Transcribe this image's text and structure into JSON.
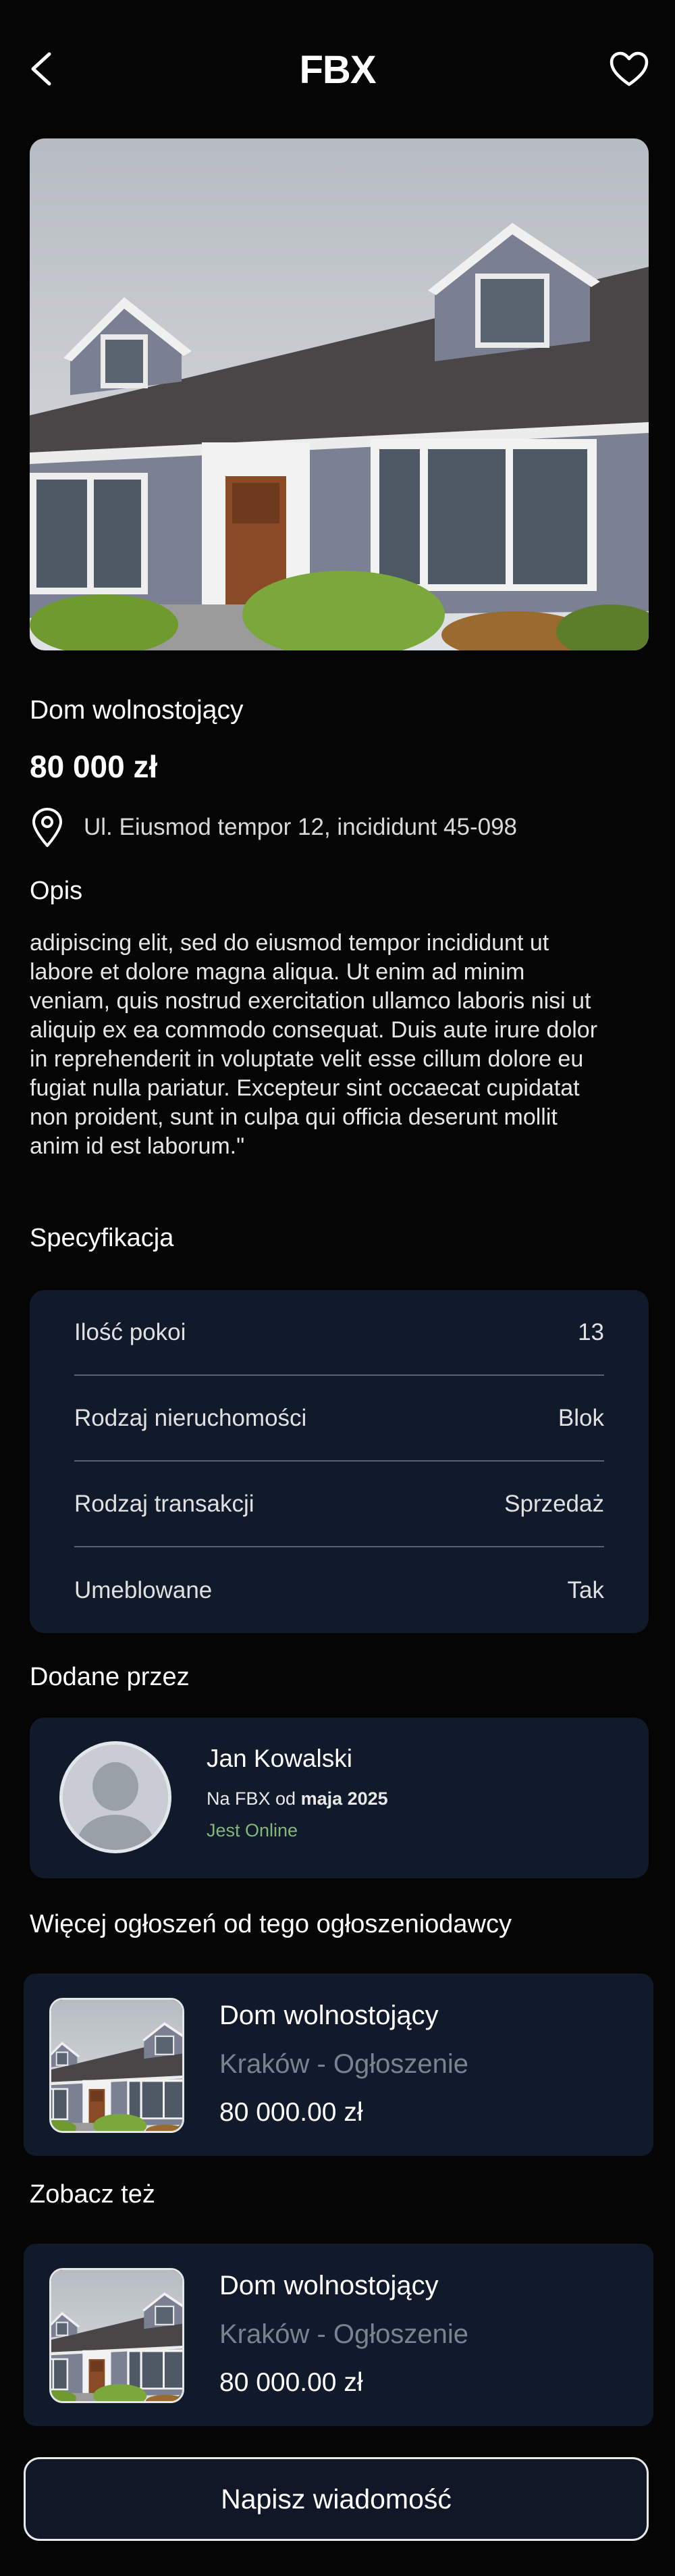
{
  "header": {
    "logo": "FBX",
    "back_icon": "chevron-left-icon",
    "favorite_icon": "heart-icon"
  },
  "listing": {
    "title": "Dom wolnostojący",
    "price": "80 000 zł",
    "address": "Ul. Eiusmod tempor 12, incididunt 45-098",
    "description_label": "Opis",
    "description": "adipiscing elit, sed do eiusmod tempor incididunt ut labore et dolore magna aliqua. Ut enim ad minim veniam, quis nostrud exercitation ullamco laboris nisi ut aliquip ex ea commodo consequat. Duis aute irure dolor in reprehenderit in voluptate velit esse cillum dolore eu fugiat nulla pariatur. Excepteur sint occaecat cupidatat non proident, sunt in culpa qui officia deserunt mollit anim id est laborum.\""
  },
  "specs": {
    "label": "Specyfikacja",
    "rows": [
      {
        "key": "Ilość pokoi",
        "value": "13"
      },
      {
        "key": "Rodzaj nieruchomości",
        "value": "Blok"
      },
      {
        "key": "Rodzaj transakcji",
        "value": "Sprzedaż"
      },
      {
        "key": "Umeblowane",
        "value": "Tak"
      }
    ]
  },
  "author": {
    "label": "Dodane przez",
    "name": "Jan Kowalski",
    "since_prefix": "Na FBX od ",
    "since_date": "maja 2025",
    "status": "Jest Online"
  },
  "more_from_seller": {
    "label": "Więcej ogłoszeń od tego ogłoszeniodawcy",
    "items": [
      {
        "title": "Dom wolnostojący",
        "location": "Kraków - Ogłoszenie",
        "price": "80 000.00 zł"
      }
    ]
  },
  "see_also": {
    "label": "Zobacz też",
    "items": [
      {
        "title": "Dom wolnostojący",
        "location": "Kraków - Ogłoszenie",
        "price": "80 000.00 zł"
      }
    ]
  },
  "cta": {
    "label": "Napisz wiadomość"
  },
  "colors": {
    "background": "#050505",
    "card": "#111a2b",
    "online": "#7fb87a",
    "muted": "#7a8292"
  }
}
